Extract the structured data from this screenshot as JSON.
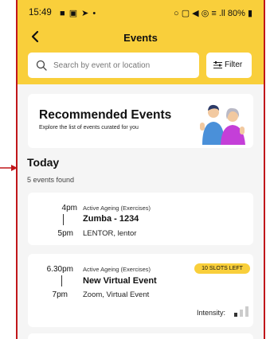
{
  "status_bar": {
    "time": "15:49",
    "left_icons": "■ ▣ ➤ •",
    "right_icons": "○ ▢ ◀ ◎ ≡ .ll",
    "battery": "80%"
  },
  "header": {
    "title": "Events"
  },
  "search": {
    "placeholder": "Search by event or location",
    "value": ""
  },
  "filter": {
    "label": "Filter"
  },
  "banner": {
    "title": "Recommended Events",
    "subtitle": "Explore the list of events curated for you"
  },
  "section": {
    "title": "Today",
    "count": "5 events found"
  },
  "events": [
    {
      "start": "4pm",
      "end": "5pm",
      "category": "Active Ageing (Exercises)",
      "name": "Zumba - 1234",
      "venue": "LENTOR, lentor"
    },
    {
      "start": "6.30pm",
      "end": "7pm",
      "category": "Active Ageing (Exercises)",
      "name": "New Virtual Event",
      "venue": "Zoom, Virtual Event",
      "badge": "10 SLOTS LEFT",
      "intensity_label": "Intensity:",
      "intensity_level": 1,
      "intensity_max": 3
    }
  ],
  "colors": {
    "header": "#f9cf3b",
    "badge": "#f9cf3b",
    "frame": "#c0161a",
    "background": "#f5f5f5"
  },
  "icons": [
    "back-arrow-icon",
    "search-icon",
    "filter-icon",
    "intensity-bars-icon"
  ]
}
